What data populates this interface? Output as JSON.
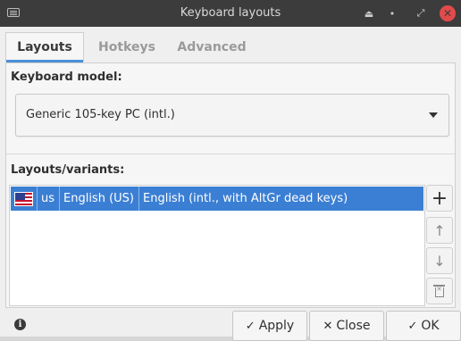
{
  "window": {
    "title": "Keyboard layouts",
    "icons": {
      "app": "keyboard-icon",
      "shade": "shade-icon",
      "minimize": "minimize-icon",
      "maximize": "maximize-icon",
      "close": "close-icon"
    }
  },
  "tabs": [
    {
      "label": "Layouts",
      "active": true
    },
    {
      "label": "Hotkeys",
      "active": false
    },
    {
      "label": "Advanced",
      "active": false
    }
  ],
  "keyboard_model": {
    "label": "Keyboard model:",
    "selected": "Generic 105-key PC (intl.)"
  },
  "layouts": {
    "label": "Layouts/variants:",
    "rows": [
      {
        "flag": "us-flag-icon",
        "code": "us",
        "name": "English (US)",
        "variant": "English (intl., with AltGr dead keys)",
        "selected": true
      }
    ]
  },
  "buttons": {
    "apply": "Apply",
    "close": "Close",
    "ok": "OK"
  },
  "colors": {
    "accent": "#4a90d9",
    "selection": "#3b7fd4",
    "titlebar": "#3c3c3c",
    "close_button": "#e14b4b"
  }
}
